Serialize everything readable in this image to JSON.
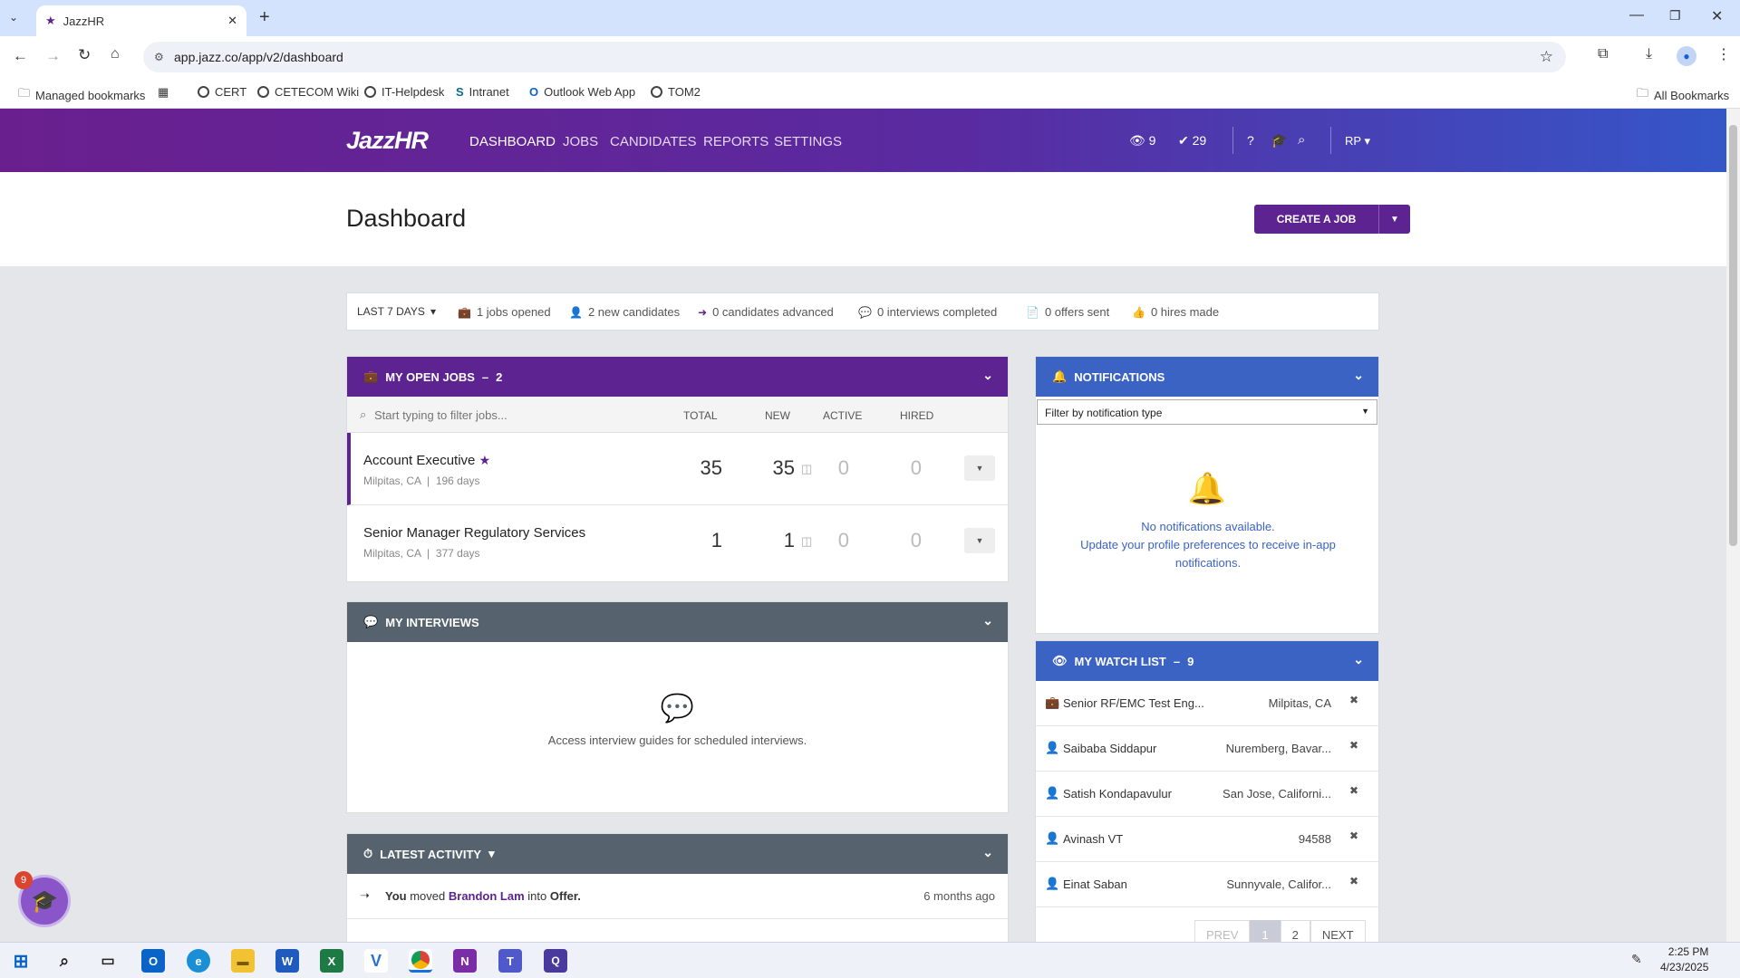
{
  "browser": {
    "tab_title": "JazzHR",
    "url": "app.jazz.co/app/v2/dashboard",
    "bookmarks": [
      "Managed bookmarks",
      "CERT",
      "CETECOM Wiki",
      "IT-Helpdesk",
      "Intranet",
      "Outlook Web App",
      "TOM2"
    ],
    "all_bookmarks": "All Bookmarks"
  },
  "header": {
    "logo": "JazzHR",
    "nav": [
      "DASHBOARD",
      "JOBS",
      "CANDIDATES",
      "REPORTS",
      "SETTINGS"
    ],
    "watch_count": "9",
    "tasks_count": "29",
    "user_initials": "RP"
  },
  "page": {
    "title": "Dashboard",
    "create_job": "CREATE A JOB"
  },
  "stats": {
    "period": "LAST 7 DAYS",
    "items": [
      "1 jobs opened",
      "2 new candidates",
      "0 candidates advanced",
      "0 interviews completed",
      "0 offers sent",
      "0 hires made"
    ]
  },
  "open_jobs": {
    "title": "MY OPEN JOBS",
    "count": "2",
    "filter_placeholder": "Start typing to filter jobs...",
    "columns": [
      "TOTAL",
      "NEW",
      "ACTIVE",
      "HIRED"
    ],
    "rows": [
      {
        "title": "Account Executive",
        "location": "Milpitas, CA",
        "age": "196 days",
        "total": "35",
        "new": "35",
        "active": "0",
        "hired": "0",
        "starred": true
      },
      {
        "title": "Senior Manager Regulatory Services",
        "location": "Milpitas, CA",
        "age": "377 days",
        "total": "1",
        "new": "1",
        "active": "0",
        "hired": "0",
        "starred": false
      }
    ]
  },
  "interviews": {
    "title": "MY INTERVIEWS",
    "empty_text": "Access interview guides for scheduled interviews."
  },
  "activity": {
    "title": "LATEST ACTIVITY",
    "items": [
      {
        "prefix": "You",
        "verb": "moved",
        "name": "Brandon Lam",
        "connector": "into",
        "target": "Offer.",
        "time": "6 months ago"
      }
    ]
  },
  "notifications": {
    "title": "NOTIFICATIONS",
    "filter_label": "Filter by notification type",
    "empty_line1": "No notifications available.",
    "empty_line2": "Update your profile preferences to receive in-app notifications."
  },
  "watchlist": {
    "title": "MY WATCH LIST",
    "count": "9",
    "rows": [
      {
        "type": "job",
        "name": "Senior RF/EMC Test Eng...",
        "location": "Milpitas, CA"
      },
      {
        "type": "person",
        "name": "Saibaba Siddapur",
        "location": "Nuremberg, Bavar..."
      },
      {
        "type": "person",
        "name": "Satish Kondapavulur",
        "location": "San Jose, Californi..."
      },
      {
        "type": "person",
        "name": "Avinash VT",
        "location": "94588"
      },
      {
        "type": "person",
        "name": "Einat Saban",
        "location": "Sunnyvale, Califor..."
      }
    ],
    "pager": [
      "PREV",
      "1",
      "2",
      "NEXT"
    ]
  },
  "help_badge": "9",
  "taskbar": {
    "time": "2:25 PM",
    "date": "4/23/2025"
  },
  "colors": {
    "brand_purple": "#5c2391",
    "panel_blue": "#3a63c4",
    "panel_slate": "#56636f"
  }
}
